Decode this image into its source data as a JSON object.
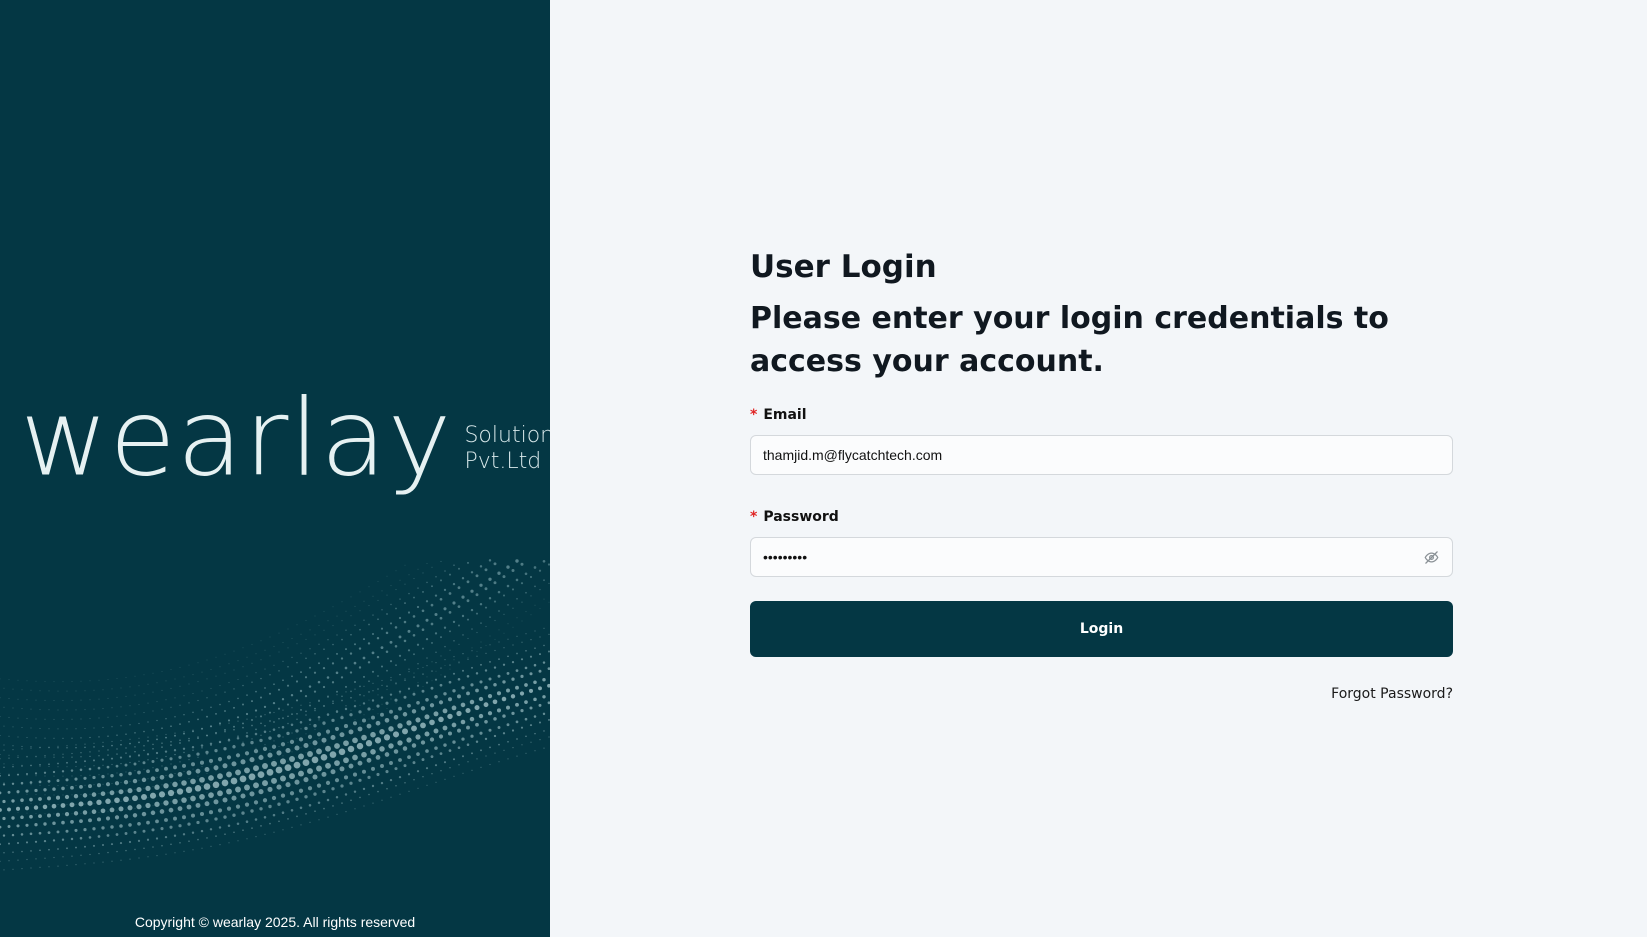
{
  "colors": {
    "brand_dark": "#043744",
    "page_bg": "#f3f6f9",
    "required_marker": "#e02424"
  },
  "brand": {
    "wordmark": "wearlay",
    "sub_line1": "Solutions",
    "sub_line2": "Pvt.Ltd"
  },
  "footer": {
    "copyright": "Copyright © wearlay 2025. All rights reserved"
  },
  "login": {
    "title": "User Login",
    "subtitle": "Please enter your login credentials to access your account.",
    "email": {
      "required_mark": "*",
      "label": "Email",
      "value": "thamjid.m@flycatchtech.com"
    },
    "password": {
      "required_mark": "*",
      "label": "Password",
      "value": "•••••••••",
      "toggle_icon": "eye-off-icon"
    },
    "submit_label": "Login",
    "forgot_label": "Forgot Password?"
  }
}
